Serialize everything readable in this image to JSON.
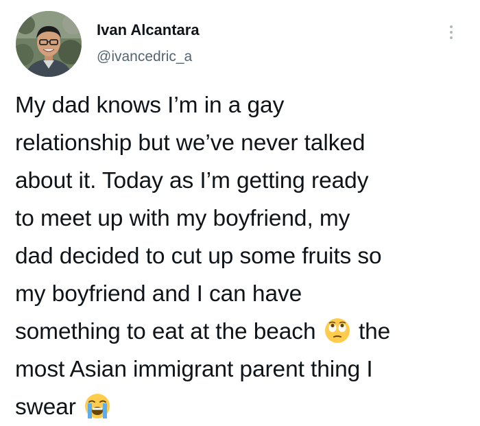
{
  "user": {
    "display_name": "Ivan Alcantara",
    "handle": "@ivancedric_a"
  },
  "tweet": {
    "lines": [
      "My dad knows I’m in a gay",
      "relationship but we’ve never talked",
      "about it. Today as I’m getting ready",
      "to meet up with my boyfriend, my",
      "dad decided to cut up some fruits so",
      "my boyfriend and I can have"
    ],
    "line7_before": "something to eat at the beach",
    "line7_after": "the",
    "line8": "most Asian immigrant parent thing I",
    "line9": "swear"
  },
  "icons": {
    "more": "vertical-ellipsis-icon",
    "emoji_1": "face-with-rolling-eyes-emoji",
    "emoji_2": "loudly-crying-face-emoji"
  },
  "colors": {
    "text": "#0f1419",
    "handle": "#536471",
    "more_dots": "#b0b9c2",
    "emoji_yellow": "#ffcc4d",
    "emoji_tear": "#5dadec"
  }
}
